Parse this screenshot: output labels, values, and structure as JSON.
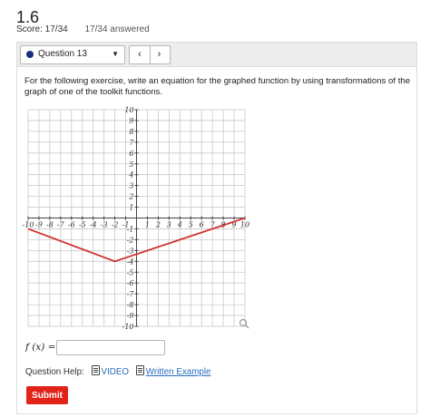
{
  "header": {
    "title": "1.6",
    "score": "Score: 17/34",
    "answered": "17/34 answered"
  },
  "question_nav": {
    "selected": "Question 13",
    "prev_label": "‹",
    "next_label": "›"
  },
  "prompt": "For the following exercise, write an equation for the graphed function by using transformations of the graph of one of the toolkit functions.",
  "chart_data": {
    "type": "line",
    "x_range": [
      -10,
      10
    ],
    "y_range": [
      -10,
      10
    ],
    "x_ticks": [
      -10,
      -9,
      -8,
      -7,
      -6,
      -5,
      -4,
      -3,
      -2,
      -1,
      1,
      2,
      3,
      4,
      5,
      6,
      7,
      8,
      9,
      10
    ],
    "y_ticks": [
      10,
      9,
      8,
      7,
      6,
      5,
      4,
      3,
      2,
      1,
      -1,
      -2,
      -3,
      -4,
      -5,
      -6,
      -7,
      -8,
      -9,
      -10
    ],
    "grid": true,
    "series": [
      {
        "points": [
          [
            -10,
            -1
          ],
          [
            -2,
            -4
          ],
          [
            10,
            0
          ]
        ],
        "color": "#d0322f"
      }
    ]
  },
  "answer": {
    "label": "f (x) =",
    "value": ""
  },
  "help": {
    "label": "Question Help:",
    "video": "VIDEO",
    "example": "Written Example"
  },
  "submit_label": "Submit"
}
